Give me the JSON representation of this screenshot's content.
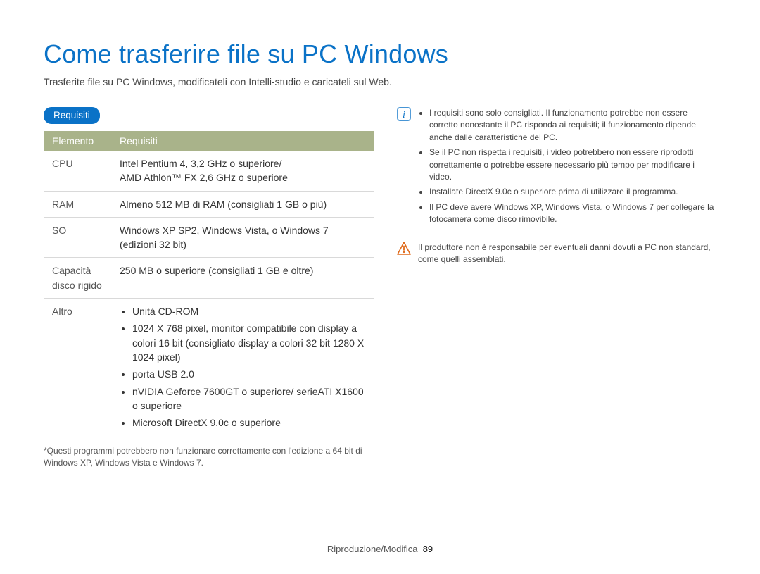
{
  "page_title": "Come trasferire file su PC Windows",
  "subtitle": "Trasferite file su PC Windows, modificateli con Intelli-studio e caricateli sul Web.",
  "requirements_label": "Requisiti",
  "table": {
    "header_element": "Elemento",
    "header_req": "Requisiti",
    "rows": {
      "cpu_label": "CPU",
      "cpu_value": "Intel Pentium 4, 3,2 GHz o superiore/\nAMD Athlon™ FX 2,6 GHz o superiore",
      "ram_label": "RAM",
      "ram_value": "Almeno 512 MB di RAM (consigliati 1 GB o più)",
      "so_label": "SO",
      "so_value": "Windows XP SP2, Windows Vista, o Windows 7\n(edizioni 32 bit)",
      "hdd_label": "Capacità disco rigido",
      "hdd_value": "250 MB o superiore (consigliati 1 GB e oltre)",
      "altro_label": "Altro",
      "altro_items": {
        "i0": "Unità CD-ROM",
        "i1": "1024 X 768 pixel, monitor compatibile con display a colori 16 bit (consigliato display a colori 32 bit 1280 X 1024 pixel)",
        "i2": "porta USB 2.0",
        "i3": "nVIDIA Geforce 7600GT o superiore/ serieATI X1600 o superiore",
        "i4": "Microsoft DirectX 9.0c o superiore"
      }
    }
  },
  "footnote": "*Questi programmi potrebbero non funzionare correttamente con l'edizione a 64 bit di Windows XP, Windows Vista e Windows 7.",
  "info_notes": {
    "n0": "I requisiti sono solo consigliati. Il funzionamento potrebbe non essere corretto nonostante il PC risponda ai requisiti; il funzionamento dipende anche dalle caratteristiche del PC.",
    "n1": "Se il PC non rispetta i requisiti, i video potrebbero non essere riprodotti correttamente o potrebbe essere necessario più tempo per modificare i video.",
    "n2": "Installate DirectX 9.0c o superiore prima di utilizzare il programma.",
    "n3": "Il PC deve avere Windows XP, Windows Vista, o Windows 7 per collegare la fotocamera come disco rimovibile."
  },
  "warning_text": "Il produttore non è responsabile per eventuali danni dovuti a PC non standard, come quelli assemblati.",
  "footer_section": "Riproduzione/Modifica",
  "footer_page": "89"
}
